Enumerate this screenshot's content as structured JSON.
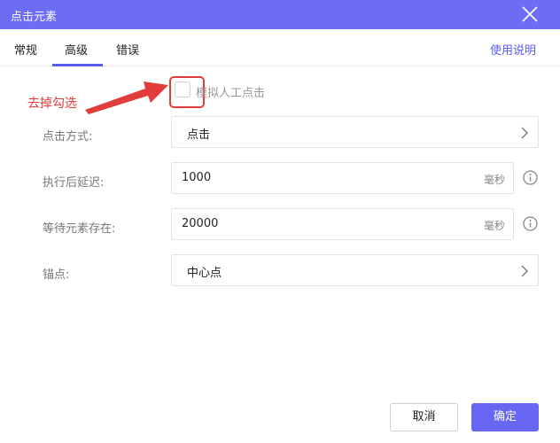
{
  "dialog": {
    "title": "点击元素"
  },
  "tabs": [
    {
      "label": "常规"
    },
    {
      "label": "高级"
    },
    {
      "label": "错误"
    }
  ],
  "active_tab": "高级",
  "help_link": "使用说明",
  "annotation": {
    "text": "去掉勾选",
    "color": "#e23c3c"
  },
  "simulate_click": {
    "label": "模拟人工点击",
    "checked": false
  },
  "fields": {
    "click_mode": {
      "label": "点击方式:",
      "value": "点击"
    },
    "delay_after": {
      "label": "执行后延迟:",
      "value": "1000",
      "unit": "毫秒"
    },
    "wait_element": {
      "label": "等待元素存在:",
      "value": "20000",
      "unit": "毫秒"
    },
    "anchor": {
      "label": "锚点:",
      "value": "中心点"
    }
  },
  "buttons": {
    "cancel": "取消",
    "ok": "确定"
  },
  "colors": {
    "accent": "#6c6cf4",
    "annotation": "#e23c3c"
  }
}
